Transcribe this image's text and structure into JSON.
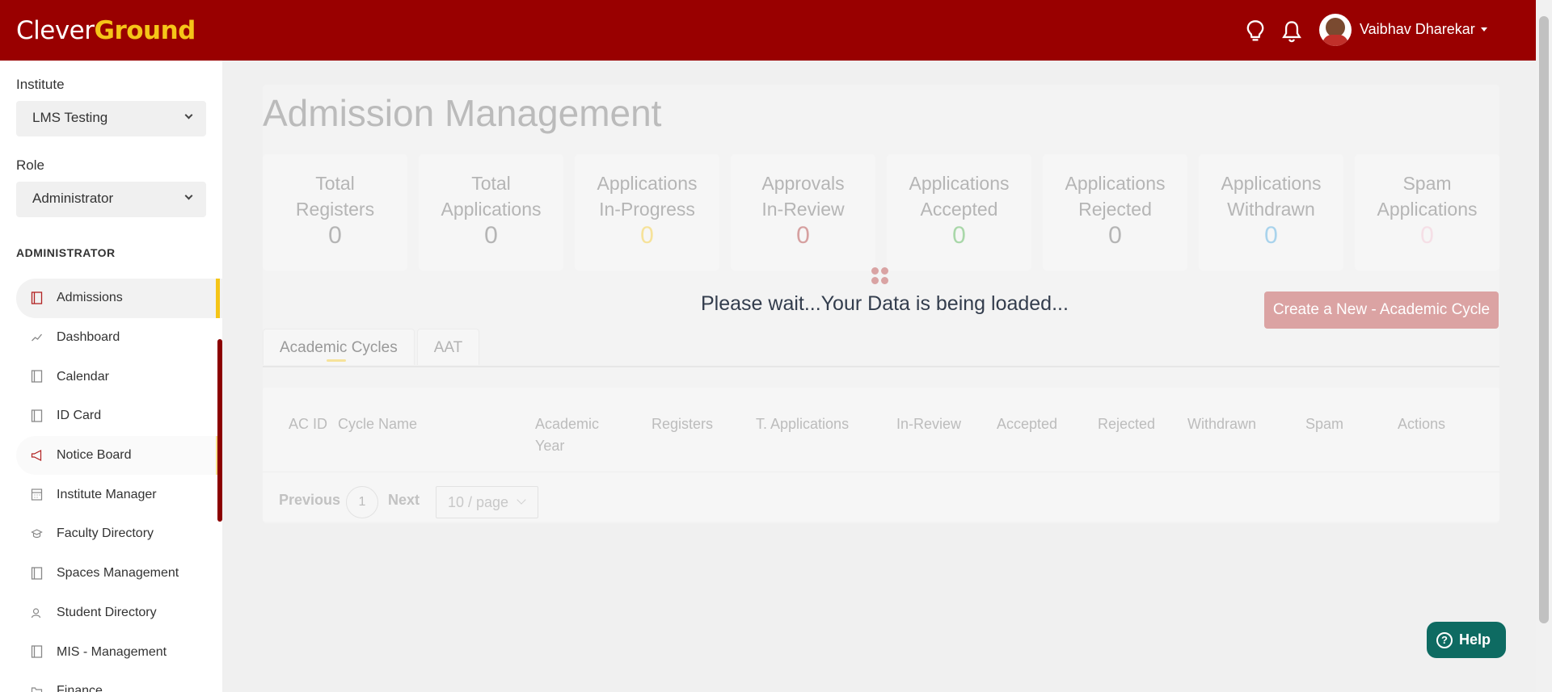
{
  "header": {
    "logo_part1": "Clever",
    "logo_part2": "Ground",
    "user_name": "Vaibhav Dharekar",
    "icons": [
      "lightbulb-icon",
      "bell-icon"
    ],
    "colors": {
      "brand": "#990000",
      "logo_accent": "#f5c518"
    }
  },
  "sidebar": {
    "institute_label": "Institute",
    "institute_value": "LMS Testing",
    "role_label": "Role",
    "role_value": "Administrator",
    "section_title": "ADMINISTRATOR",
    "items": [
      {
        "label": "Admissions",
        "icon": "book-icon"
      },
      {
        "label": "Dashboard",
        "icon": "line-chart-icon"
      },
      {
        "label": "Calendar",
        "icon": "book-icon"
      },
      {
        "label": "ID Card",
        "icon": "book-icon"
      },
      {
        "label": "Notice Board",
        "icon": "megaphone-icon"
      },
      {
        "label": "Institute Manager",
        "icon": "calendar-icon"
      },
      {
        "label": "Faculty Directory",
        "icon": "graduation-cap-icon"
      },
      {
        "label": "Spaces Management",
        "icon": "book-icon"
      },
      {
        "label": "Student Directory",
        "icon": "users-icon"
      },
      {
        "label": "MIS - Management",
        "icon": "book-icon"
      },
      {
        "label": "Finance",
        "icon": "folder-icon"
      }
    ]
  },
  "main": {
    "title": "Admission Management",
    "cards": [
      {
        "line1": "Total",
        "line2": "Registers",
        "value": "0"
      },
      {
        "line1": "Total",
        "line2": "Applications",
        "value": "0"
      },
      {
        "line1": "Applications",
        "line2": "In-Progress",
        "value": "0"
      },
      {
        "line1": "Approvals",
        "line2": "In-Review",
        "value": "0"
      },
      {
        "line1": "Applications",
        "line2": "Accepted",
        "value": "0"
      },
      {
        "line1": "Applications",
        "line2": "Rejected",
        "value": "0"
      },
      {
        "line1": "Applications",
        "line2": "Withdrawn",
        "value": "0"
      },
      {
        "line1": "Spam",
        "line2": "Applications",
        "value": "0"
      }
    ],
    "loading_text": "Please wait...Your Data is being loaded...",
    "create_button": "Create a New - Academic Cycle",
    "tabs": [
      "Academic Cycles",
      "AAT"
    ],
    "table": {
      "headers": [
        "AC ID",
        "Cycle Name",
        "Academic",
        "Year",
        "Registers",
        "T. Applications",
        "In-Review",
        "Accepted",
        "Rejected",
        "Withdrawn",
        "Spam",
        "Actions"
      ]
    },
    "pagination": {
      "previous": "Previous",
      "current_page": "1",
      "next": "Next",
      "page_size": "10 / page"
    }
  },
  "help_button": "Help"
}
